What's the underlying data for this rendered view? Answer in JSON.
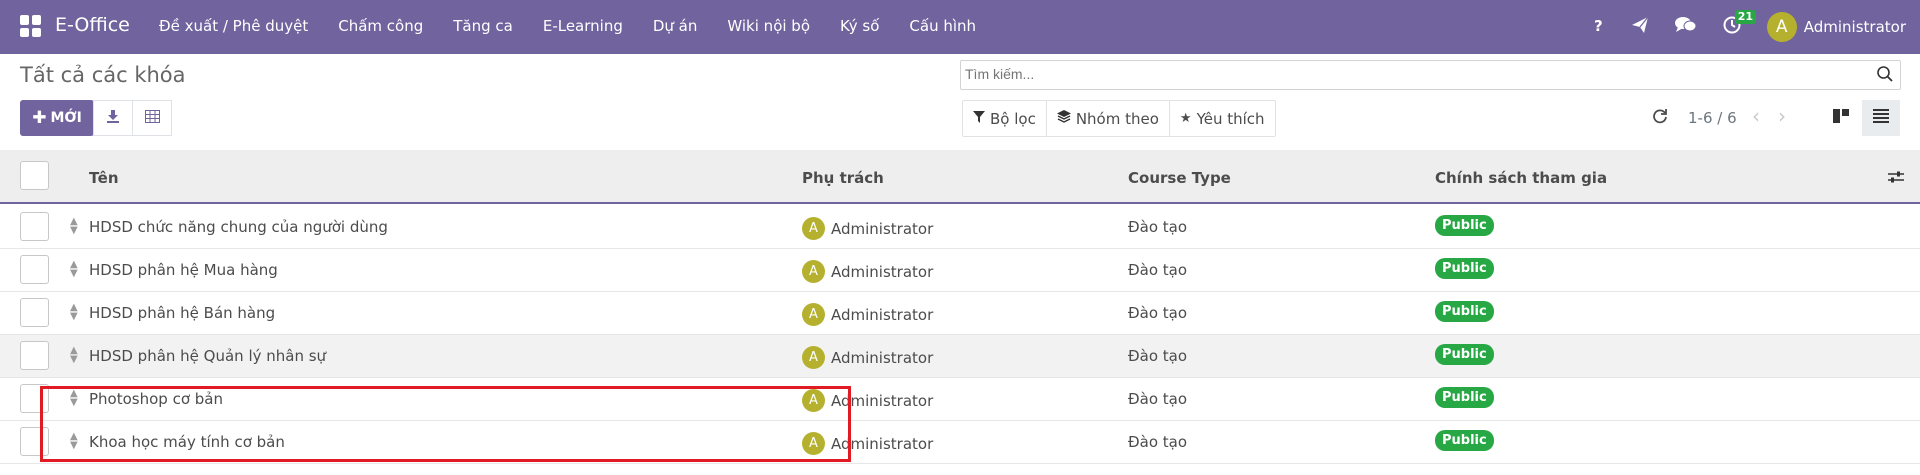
{
  "navbar": {
    "brand": "E-Office",
    "menu": [
      "Đề xuất / Phê duyệt",
      "Chấm công",
      "Tăng ca",
      "E-Learning",
      "Dự án",
      "Wiki nội bộ",
      "Ký số",
      "Cấu hình"
    ],
    "activity_count": "21",
    "avatar_letter": "A",
    "user_name": "Administrator",
    "icons": [
      "help-icon",
      "paper-plane-icon",
      "chat-icon",
      "clock-icon"
    ]
  },
  "control_panel": {
    "title": "Tất cả các khóa",
    "new_label": "MỚI",
    "search_placeholder": "Tìm kiếm...",
    "filters": [
      "Bộ lọc",
      "Nhóm theo",
      "Yêu thích"
    ],
    "pager": "1-6 / 6"
  },
  "table": {
    "columns": [
      "Tên",
      "Phụ trách",
      "Course Type",
      "Chính sách tham gia"
    ],
    "rows": [
      {
        "name": "HDSD chức năng chung của người dùng",
        "responsible": "Administrator",
        "avatar": "A",
        "type": "Đào tạo",
        "policy": "Public"
      },
      {
        "name": "HDSD phân hệ Mua hàng",
        "responsible": "Administrator",
        "avatar": "A",
        "type": "Đào tạo",
        "policy": "Public"
      },
      {
        "name": "HDSD phân hệ Bán hàng",
        "responsible": "Administrator",
        "avatar": "A",
        "type": "Đào tạo",
        "policy": "Public"
      },
      {
        "name": "HDSD phân hệ Quản lý nhân sự",
        "responsible": "Administrator",
        "avatar": "A",
        "type": "Đào tạo",
        "policy": "Public"
      },
      {
        "name": "Photoshop cơ bản",
        "responsible": "Administrator",
        "avatar": "A",
        "type": "Đào tạo",
        "policy": "Public"
      },
      {
        "name": "Khoa học máy tính cơ bản",
        "responsible": "Administrator",
        "avatar": "A",
        "type": "Đào tạo",
        "policy": "Public"
      }
    ]
  },
  "colors": {
    "brand": "#71639e",
    "success": "#28a745",
    "avatar": "#b5b12e",
    "annotation": "#e01b24"
  }
}
